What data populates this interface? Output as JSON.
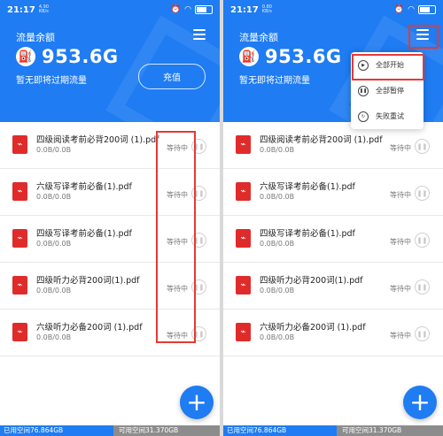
{
  "status_left": {
    "time": "21:17",
    "speed": "4.90 KB/s"
  },
  "status_right": {
    "time": "21:17",
    "speed": "0.80 KB/s"
  },
  "header": {
    "title": "流量余额",
    "amount": "953.6G",
    "expire_note": "暂无即将过期流量",
    "recharge_label": "充值"
  },
  "files": [
    {
      "name": "四级阅读考前必背200词 (1).pdf",
      "size": "0.0B/0.0B",
      "status": "等待中"
    },
    {
      "name": "六级写译考前必备(1).pdf",
      "size": "0.0B/0.0B",
      "status": "等待中"
    },
    {
      "name": "四级写译考前必备(1).pdf",
      "size": "0.0B/0.0B",
      "status": "等待中"
    },
    {
      "name": "四级听力必背200词(1).pdf",
      "size": "0.0B/0.0B",
      "status": "等待中"
    },
    {
      "name": "六级听力必备200词 (1).pdf",
      "size": "0.0B/0.0B",
      "status": "等待中"
    }
  ],
  "footer": {
    "used": "已用空间76.864GB",
    "available": "可用空间31.370GB"
  },
  "menu": {
    "start_all": "全部开始",
    "pause_all": "全部暂停",
    "retry_failed": "失败重试"
  },
  "icons": {
    "fuel": "gas-station-icon",
    "file": "pdf-file-icon",
    "pause": "pause-icon",
    "add": "plus-icon",
    "menu": "hamburger-menu-icon"
  },
  "colors": {
    "brand": "#1f7cf2",
    "highlight": "#e53935",
    "pdf": "#e02b2b"
  }
}
